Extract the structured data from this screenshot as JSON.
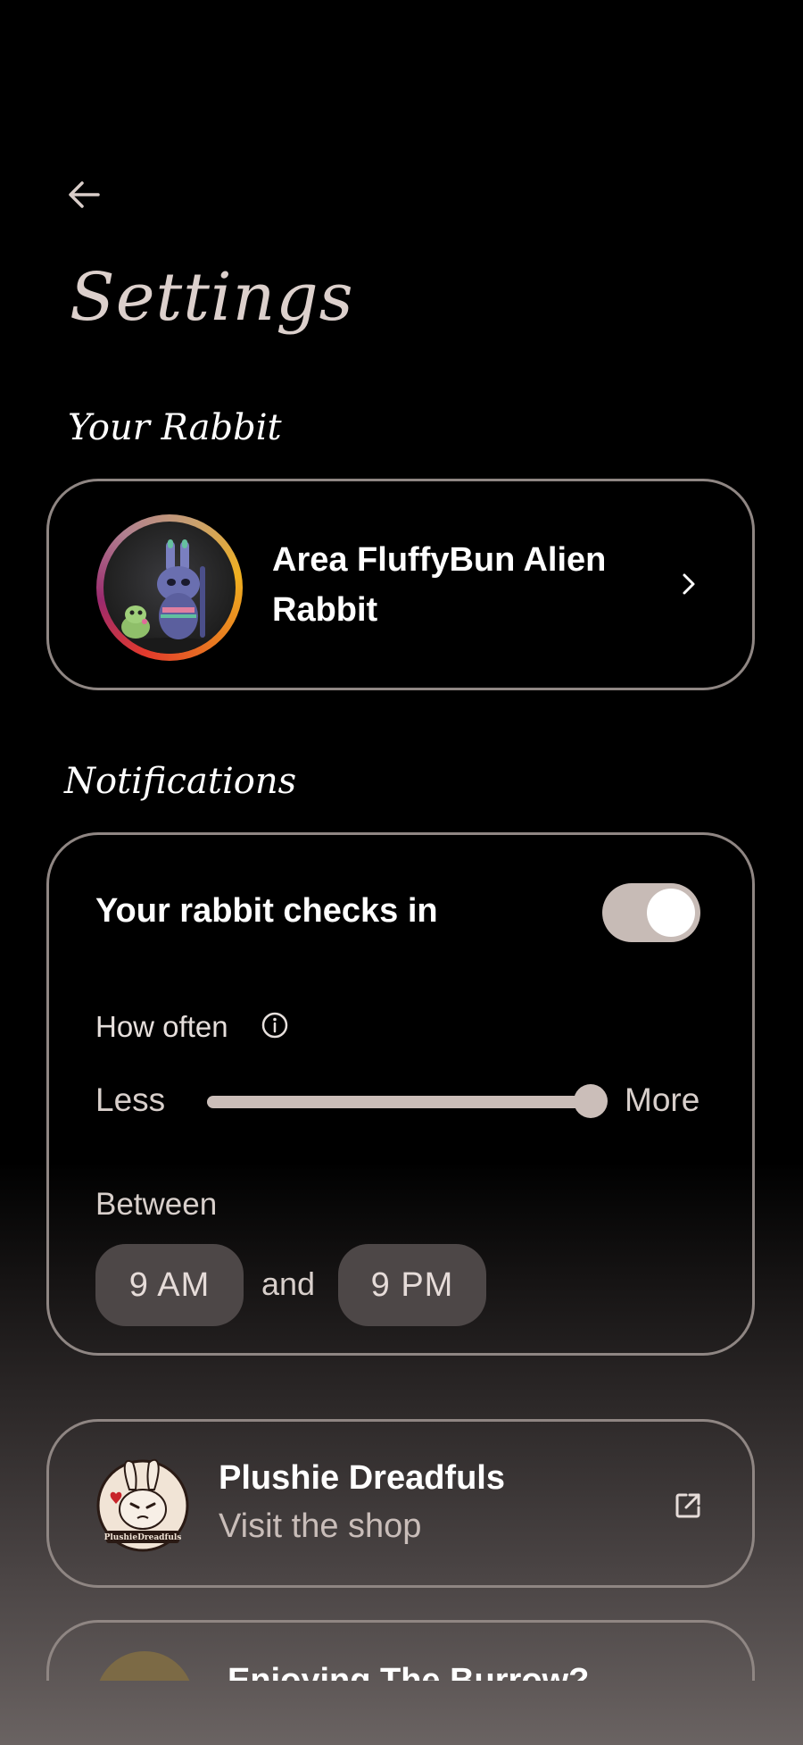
{
  "header": {
    "back_icon": "arrow-left-icon",
    "title": "Settings"
  },
  "rabbit_section": {
    "title": "Your Rabbit",
    "rabbit_name": "Area FluffyBun Alien Rabbit",
    "chevron_icon": "chevron-right-icon"
  },
  "notifications": {
    "title": "Notifications",
    "checkin_label": "Your rabbit checks in",
    "checkin_enabled": true,
    "how_often_label": "How often",
    "info_icon": "info-icon",
    "slider": {
      "min_label": "Less",
      "max_label": "More",
      "value": 1.0
    },
    "between_label": "Between",
    "start_time": "9 AM",
    "and_label": "and",
    "end_time": "9 PM"
  },
  "shop": {
    "name": "Plushie Dreadfuls",
    "subtitle": "Visit the shop",
    "logo_text": "PlushieDreadfuls",
    "external_icon": "external-link-icon"
  },
  "enjoy": {
    "title": "Enjoying The Burrow?"
  },
  "colors": {
    "accent": "#c7bbb6",
    "card_border": "#8f8683",
    "pill_bg": "#4d4747",
    "title_color": "#dcd0cc"
  }
}
